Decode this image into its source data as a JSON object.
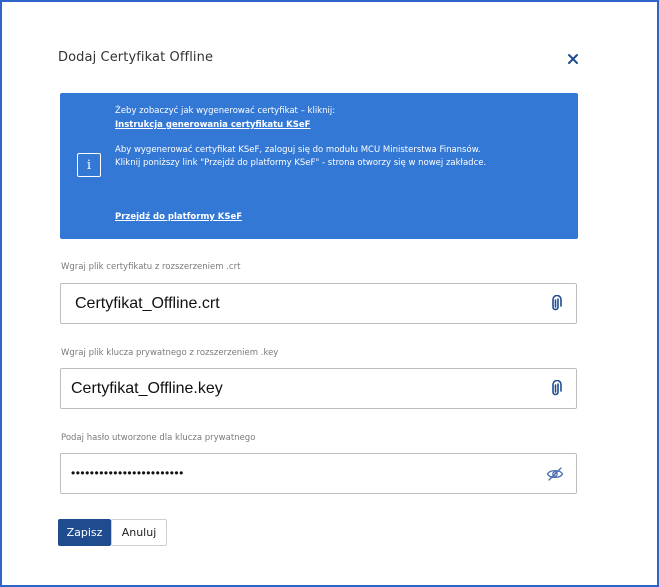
{
  "dialog": {
    "title": "Dodaj Certyfikat Offline",
    "close_icon": "close-icon"
  },
  "info": {
    "icon": "info-icon",
    "line1": "Żeby zobaczyć jak wygenerować certyfikat – kliknij:",
    "link1": "Instrukcja generowania certyfikatu KSeF",
    "line2": "Aby wygenerować certyfikat KSeF, zaloguj się do modułu MCU Ministerstwa Finansów.",
    "line3": "Kliknij poniższy link \"Przejdź do platformy KSeF\" - strona otworzy się w nowej zakładce.",
    "link2": "Przejdź do platformy KSeF"
  },
  "fields": [
    {
      "label": "Wgraj plik certyfikatu z rozszerzeniem .crt",
      "value": "Certyfikat_Offline.crt",
      "icon": "paperclip-icon"
    },
    {
      "label": "Wgraj plik klucza prywatnego z rozszerzeniem .key",
      "value": "Certyfikat_Offline.key",
      "icon": "paperclip-icon"
    },
    {
      "label": "Podaj hasło utworzone dla klucza prywatnego",
      "value": "••••••••••••••••••••••••",
      "icon": "eye-slash-icon"
    }
  ],
  "actions": {
    "save_label": "Zapisz",
    "cancel_label": "Anuluj"
  },
  "colors": {
    "accent": "#3478d6",
    "primary_button": "#1e4c8f",
    "frame_border": "#2f64c8"
  }
}
